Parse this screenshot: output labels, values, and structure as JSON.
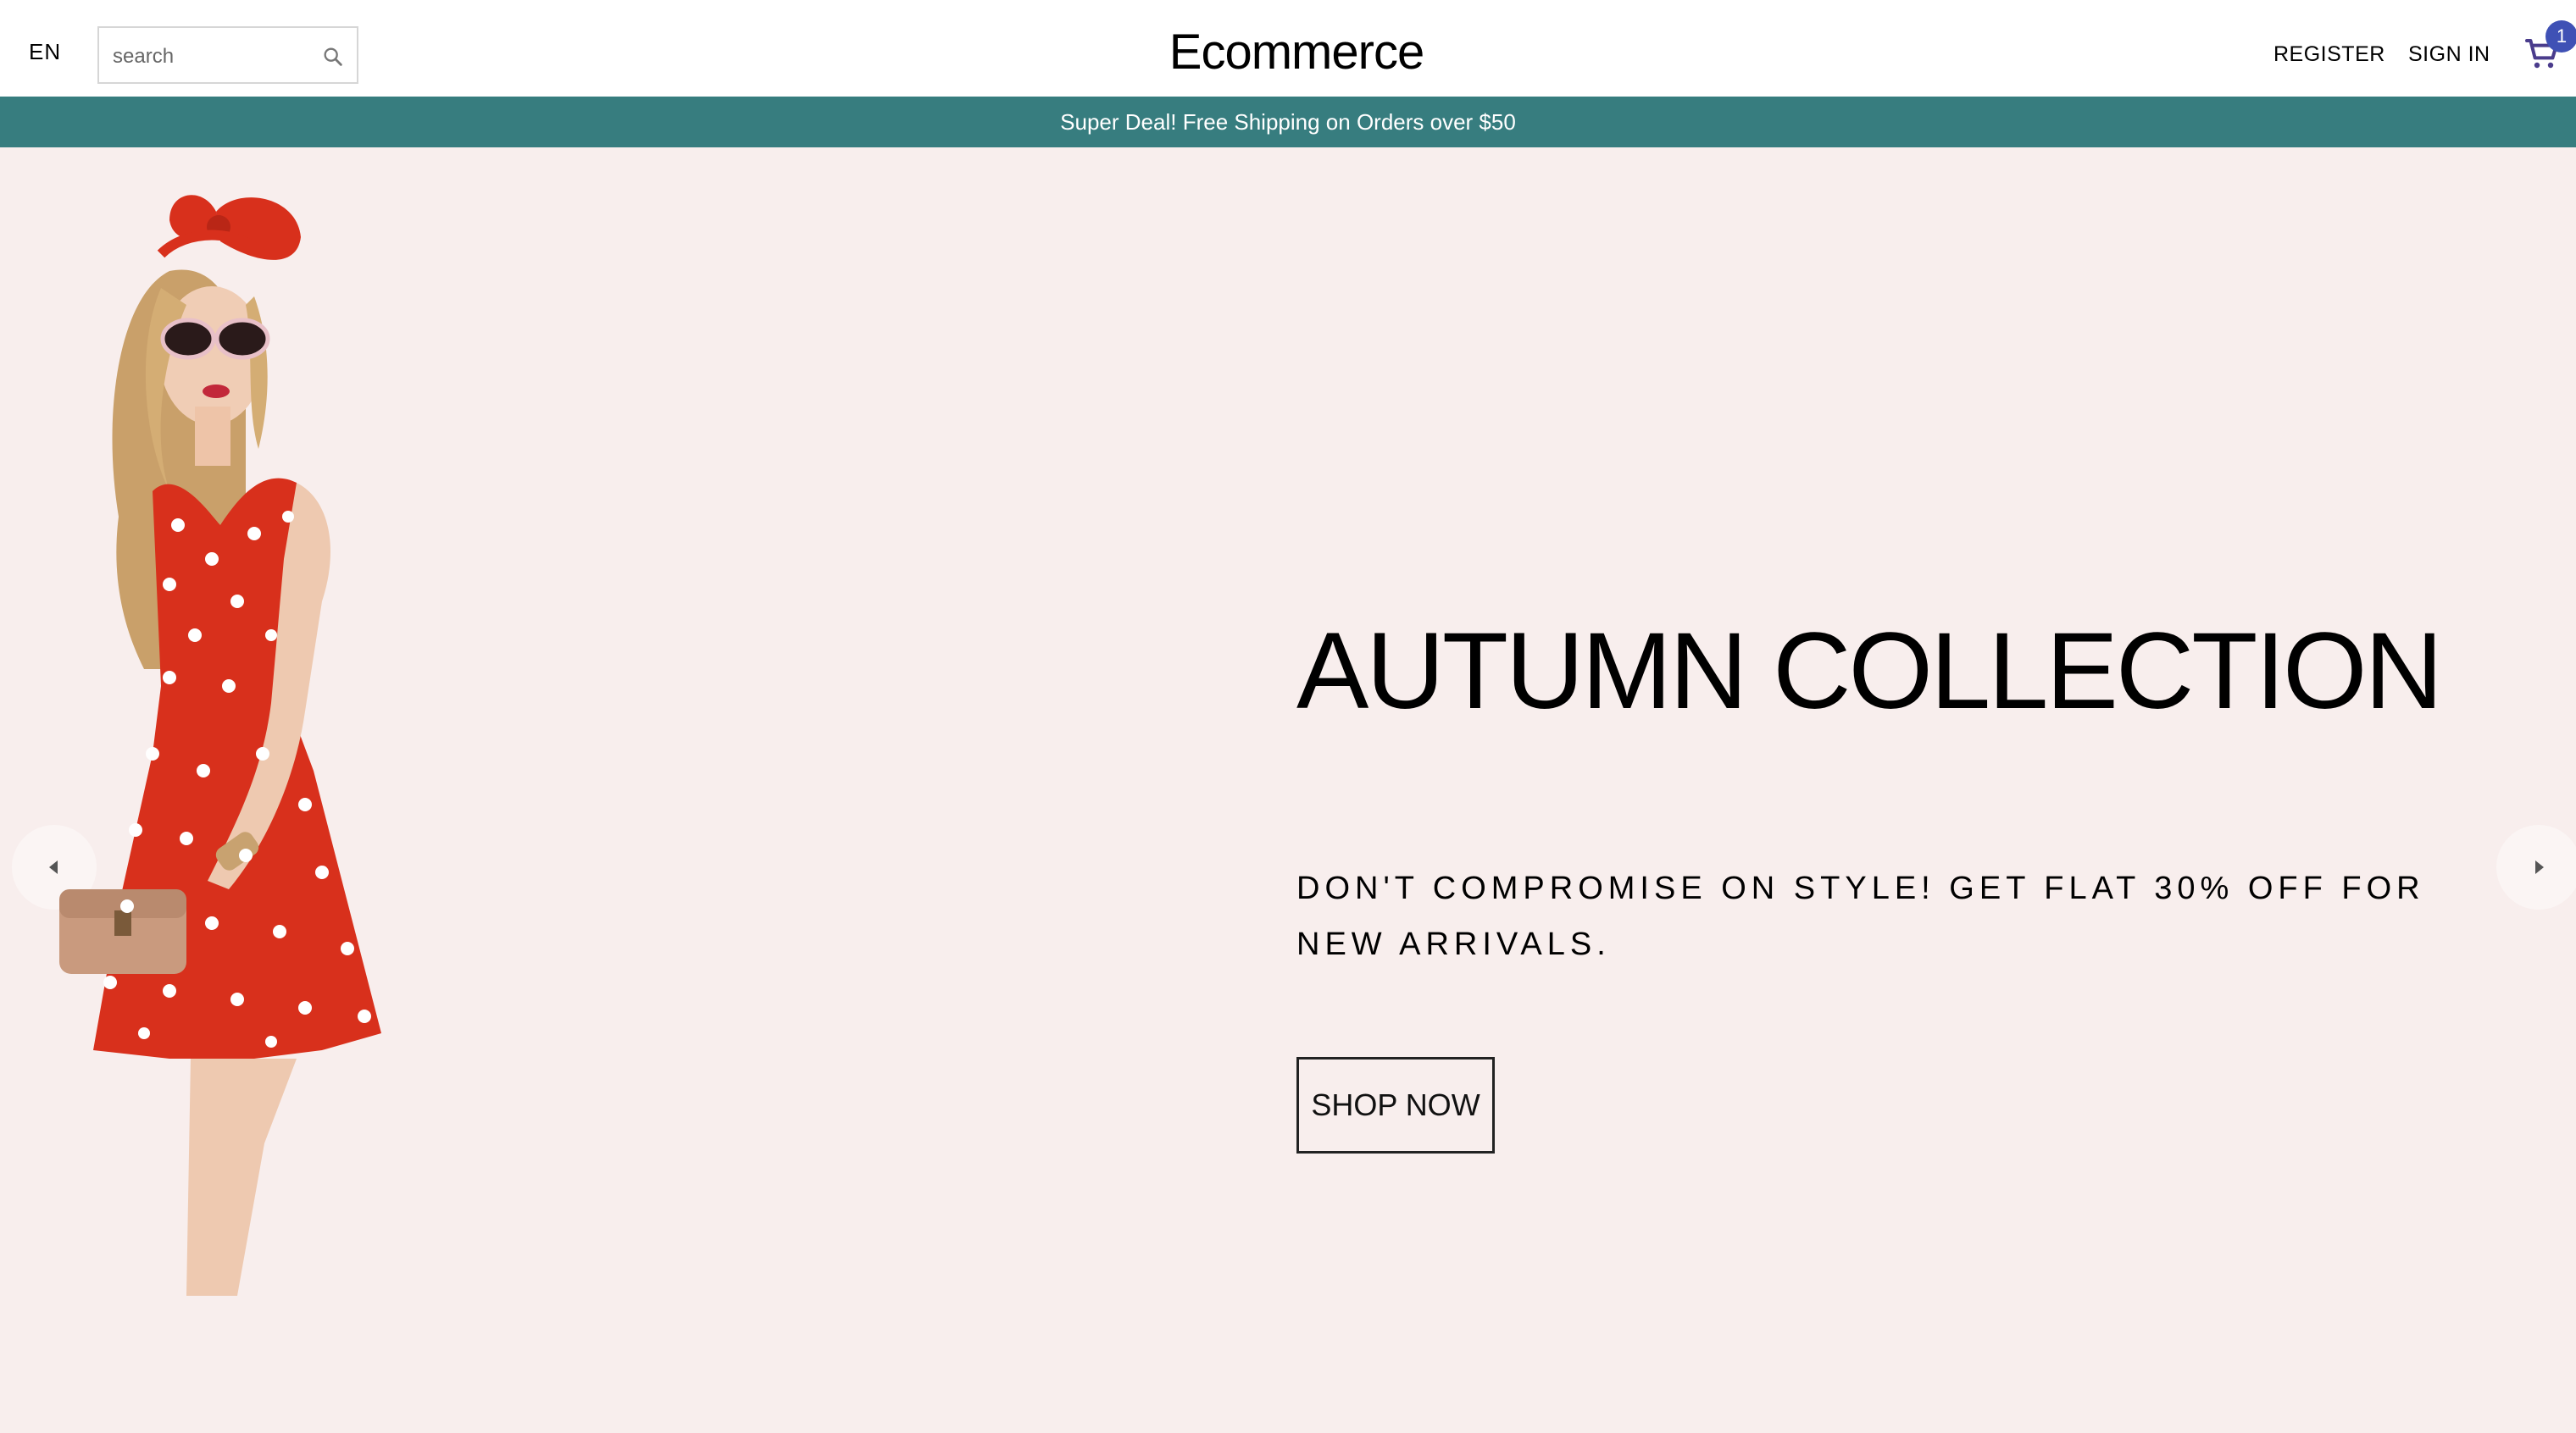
{
  "header": {
    "language": "EN",
    "search_placeholder": "search",
    "logo": "Ecommerce",
    "register_label": "REGISTER",
    "signin_label": "SIGN IN",
    "cart_count": "1"
  },
  "announcement": {
    "text": "Super Deal! Free Shipping on Orders over $50"
  },
  "slide": {
    "title": "AUTUMN COLLECTION",
    "description": "DON'T COMPROMISE ON STYLE! GET FLAT 30% OFF FOR NEW ARRIVALS.",
    "button_label": "SHOP NOW"
  },
  "colors": {
    "announcement_bg": "#377d7f",
    "hero_bg": "#f8eeed",
    "badge_bg": "#3f51b5",
    "dress_red": "#d8301c"
  },
  "icons": {
    "search": "search-icon",
    "cart": "shopping-cart-icon",
    "prev": "arrow-left-icon",
    "next": "arrow-right-icon"
  }
}
